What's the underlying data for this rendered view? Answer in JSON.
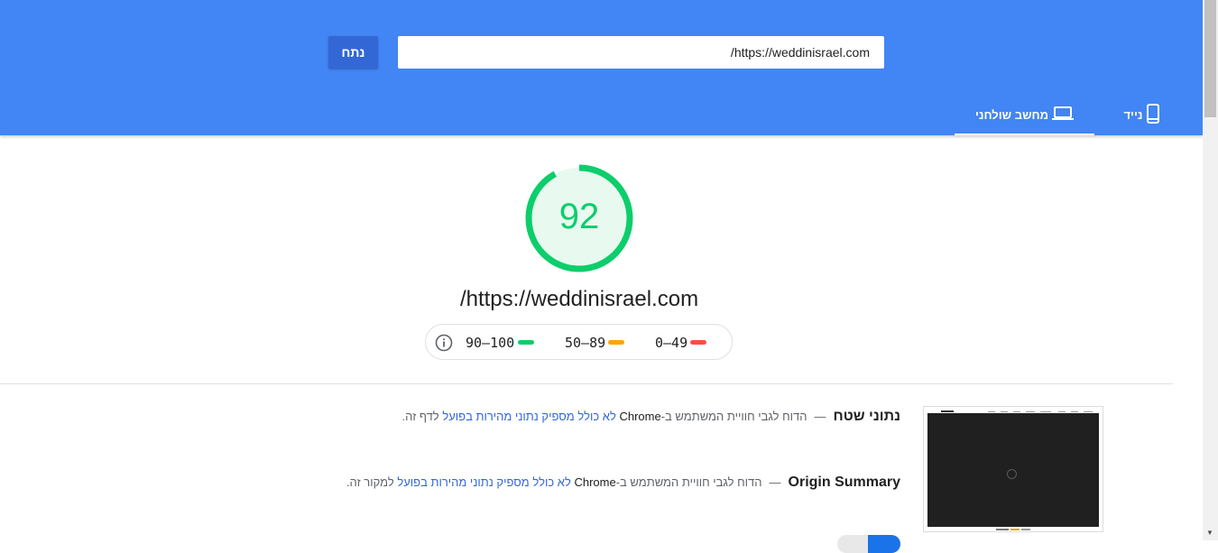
{
  "header": {
    "url_value": "https://weddinisrael.com/",
    "analyze_label": "נתח",
    "tabs": [
      {
        "label": "מחשב שולחני",
        "icon": "laptop-icon",
        "selected": true
      },
      {
        "label": "נייד",
        "icon": "mobile-phone-icon",
        "selected": false
      }
    ]
  },
  "score": {
    "value": "92",
    "fraction": 0.92,
    "color": "#0cce6b",
    "page_url": "https://weddinisrael.com/"
  },
  "legend": {
    "info_icon": "info-icon",
    "ranges": [
      {
        "label": "90–100",
        "color": "#0cce6b"
      },
      {
        "label": "50–89",
        "color": "#ffa400"
      },
      {
        "label": "0–49",
        "color": "#ff4e42"
      }
    ]
  },
  "sections": [
    {
      "title": "נתוני שטח",
      "dash": "—",
      "text_before": "הדוח לגבי חוויית המשתמש ב-",
      "chrome": "Chrome",
      "link": "לא כולל מספיק נתוני מהירות בפועל",
      "text_after": "לדף זה."
    },
    {
      "title": "Origin Summary",
      "dash": "—",
      "text_before": "הדוח לגבי חוויית המשתמש ב-",
      "chrome": "Chrome",
      "link": "לא כולל מספיק נתוני מהירות בפועל",
      "text_after": "למקור זה."
    }
  ],
  "colors": {
    "header_bg": "#4285f4",
    "button_bg": "#3367d6",
    "link": "#3367d6",
    "good": "#0cce6b",
    "average": "#ffa400",
    "fail": "#ff4e42"
  }
}
